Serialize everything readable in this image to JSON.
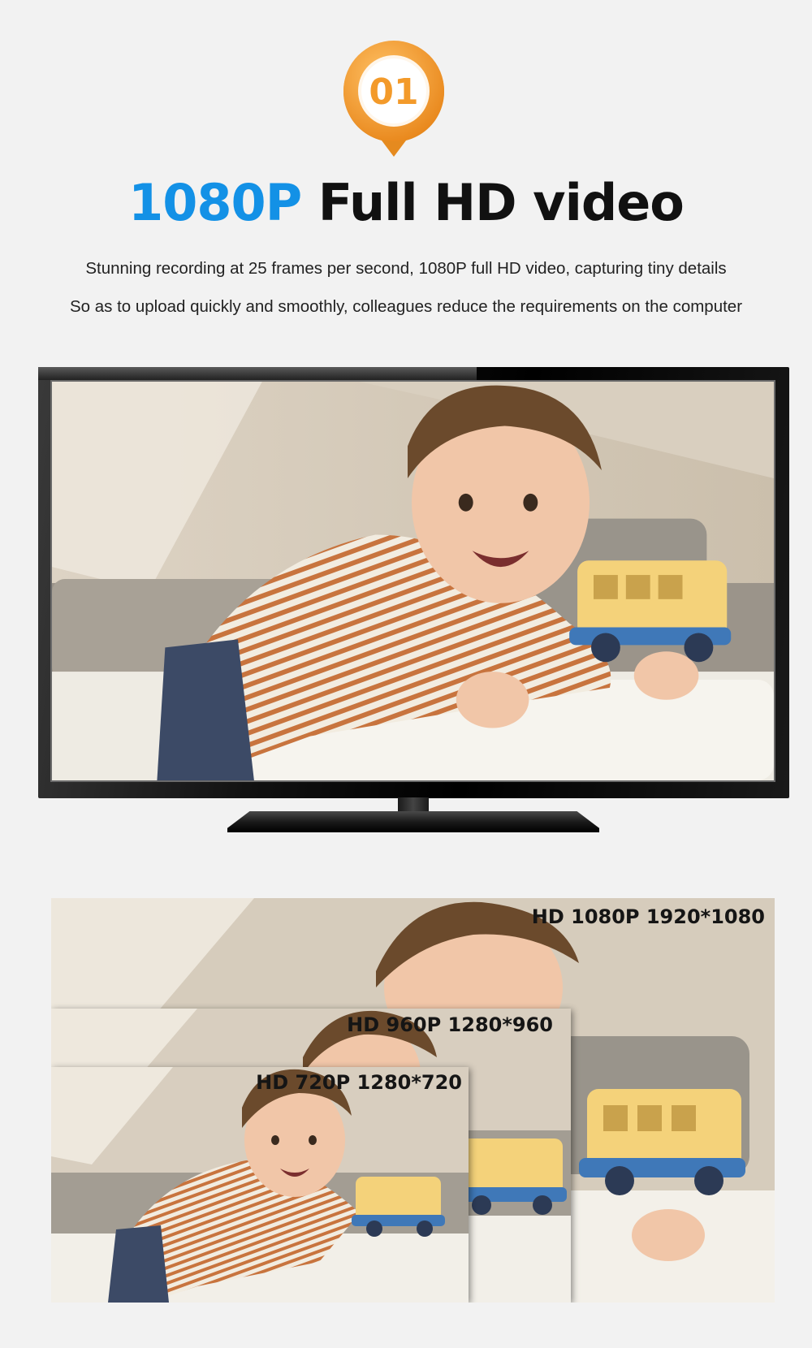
{
  "badge": {
    "number": "01",
    "color": "#f39a2a"
  },
  "headline": {
    "accent": "1080P",
    "rest": "Full HD video",
    "accent_color": "#1391e6"
  },
  "description": {
    "line1": "Stunning recording at 25 frames per second, 1080P full HD video, capturing tiny details",
    "line2": "So as to upload quickly and smoothly, colleagues reduce the requirements on the computer"
  },
  "resolutions": [
    {
      "label": "HD 1080P 1920*1080"
    },
    {
      "label": "HD 960P 1280*960"
    },
    {
      "label": "HD 720P 1280*720"
    }
  ]
}
